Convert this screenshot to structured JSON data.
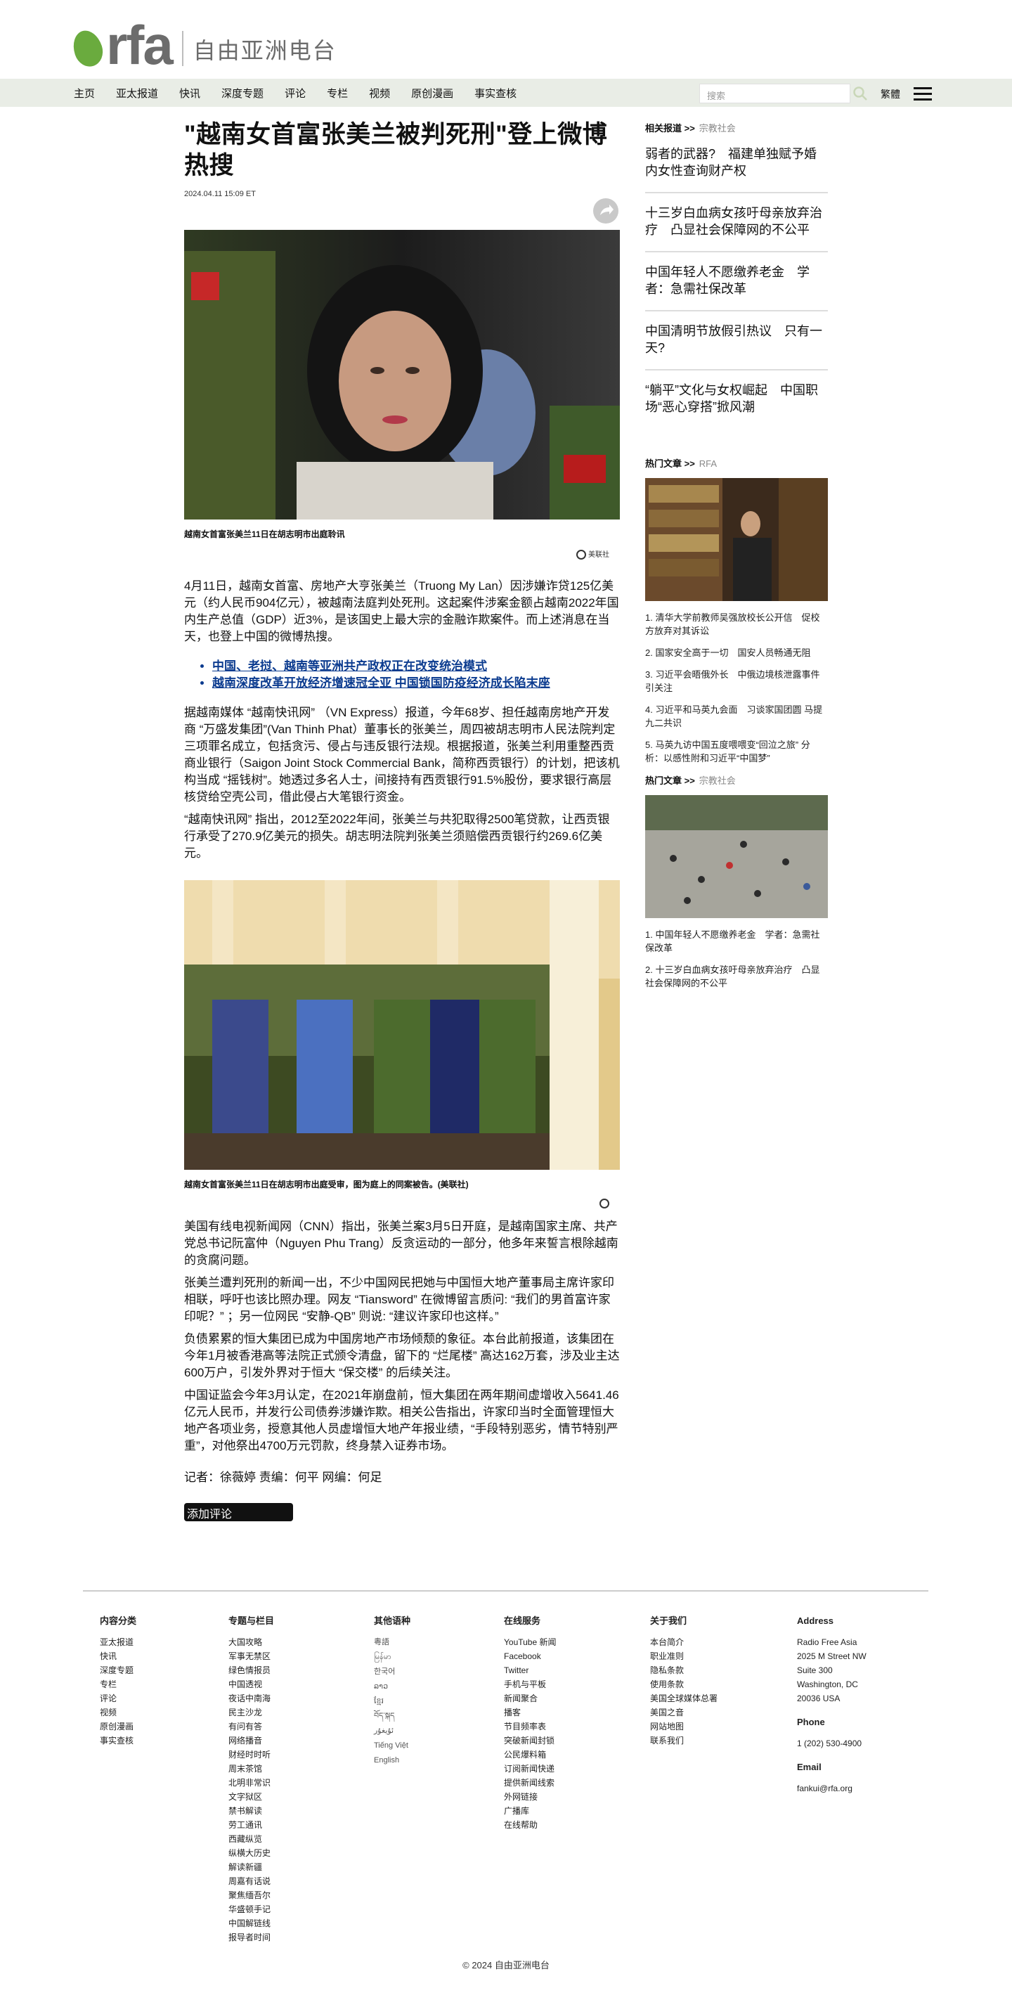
{
  "header": {
    "logo_text": "rfa",
    "site_name": "自由亚洲电台",
    "nav": [
      "主页",
      "亚太报道",
      "快讯",
      "深度专题",
      "评论",
      "专栏",
      "视频",
      "原创漫画",
      "事实查核"
    ],
    "search_placeholder": "搜索",
    "traditional_label": "繁體"
  },
  "article": {
    "title": "\"越南女首富张美兰被判死刑\"登上微博热搜",
    "date": "2024.04.11 15:09 ET",
    "image1_caption": "越南女首富张美兰11日在胡志明市出庭聆讯",
    "image1_credit": "美联社",
    "para1": "4月11日，越南女首富、房地产大亨张美兰（Truong My Lan）因涉嫌诈贷125亿美元（约人民币904亿元），被越南法庭判处死刑。这起案件涉案金额占越南2022年国内生产总值（GDP）近3%，是该国史上最大宗的金融诈欺案件。而上述消息在当天，也登上中国的微博热搜。",
    "links": [
      "中国、老挝、越南等亚洲共产政权正在改变统治模式",
      "越南深度改革开放经济增速冠全亚 中国锁国防疫经济成长陷末座"
    ],
    "para2": "据越南媒体 “越南快讯网” （VN Express）报道，今年68岁、担任越南房地产开发商 “万盛发集团”(Van Thinh Phat）董事长的张美兰，周四被胡志明市人民法院判定三项罪名成立，包括贪污、侵占与违反银行法规。根据报道，张美兰利用重整西贡商业银行（Saigon Joint Stock Commercial Bank，简称西贡银行）的计划，把该机构当成 “摇钱树”。她透过多名人士，间接持有西贡银行91.5%股份，要求银行高层核贷给空壳公司，借此侵占大笔银行资金。",
    "para3": " “越南快讯网” 指出，2012至2022年间，张美兰与共犯取得2500笔贷款，让西贡银行承受了270.9亿美元的损失。胡志明法院判张美兰须赔偿西贡银行约269.6亿美元。",
    "image2_caption": "越南女首富张美兰11日在胡志明市出庭受审，图为庭上的同案被告。(美联社)",
    "para4": "美国有线电视新闻网（CNN）指出，张美兰案3月5日开庭，是越南国家主席、共产党总书记阮富仲（Nguyen Phu Trang）反贪运动的一部分，他多年来誓言根除越南的贪腐问题。",
    "para5": "张美兰遭判死刑的新闻一出，不少中国网民把她与中国恒大地产董事局主席许家印相联，呼吁也该比照办理。网友 “Tiansword” 在微博留言质问: “我们的男首富许家印呢？” ；另一位网民 “安静-QB” 则说: “建议许家印也这样。”",
    "para6": "负债累累的恒大集团已成为中国房地产市场倾颓的象征。本台此前报道，该集团在今年1月被香港高等法院正式颁令清盘，留下的 “烂尾楼” 高达162万套，涉及业主达600万户，引发外界对于恒大 “保交楼” 的后续关注。",
    "para7": "中国证监会今年3月认定，在2021年崩盘前，恒大集团在两年期间虚增收入5641.46亿元人民币，并发行公司债券涉嫌诈欺。相关公告指出，许家印当时全面管理恒大地产各项业务，授意其他人员虚增恒大地产年报业绩，“手段特别恶劣，情节特别严重”，对他祭出4700万元罚款，终身禁入证券市场。",
    "credits": "记者：徐薇婷   责编：何平   网编：何足",
    "comment_button": "添加评论"
  },
  "sidebar": {
    "related_head": "相关报道 >>",
    "related_sub": "宗教社会",
    "related": [
      "弱者的武器?　福建单独赋予婚内女性查询财产权",
      "十三岁白血病女孩吁母亲放弃治疗　凸显社会保障网的不公平",
      "中国年轻人不愿缴养老金　学者：急需社保改革",
      "中国清明节放假引热议　只有一天?",
      "“躺平”文化与女权崛起　中国职场“恶心穿搭”掀风潮"
    ],
    "hot1_head": "热门文章 >>",
    "hot1_sub": "RFA",
    "hot1": [
      "1. 清华大学前教师吴强放校长公开信　促校方放弃对其诉讼",
      "2. 国家安全高于一切　国安人员畅通无阻",
      "3. 习近平会晤俄外长　中俄边境核泄露事件引关注",
      "4. 习近平和马英九会面　习谈家国团圆 马提九二共识",
      "5. 马英九访中国五度喂喂变“回泣之旅” 分析：以感性附和习近平“中国梦”"
    ],
    "hot2_head": "热门文章 >>",
    "hot2_sub": "宗教社会",
    "hot2": [
      "1. 中国年轻人不愿缴养老金　学者：急需社保改革",
      "2. 十三岁白血病女孩吁母亲放弃治疗　凸显社会保障网的不公平"
    ]
  },
  "footer": {
    "col1_head": "内容分类",
    "col1": [
      "亚太报道",
      "快讯",
      "深度专题",
      "专栏",
      "评论",
      "视频",
      "原创漫画",
      "事实查核"
    ],
    "col2_head": "专题与栏目",
    "col2": [
      "大国攻略",
      "军事无禁区",
      "绿色情报员",
      "中国透视",
      "夜话中南海",
      "民主沙龙",
      "有问有答",
      "网络播音",
      "财经时时听",
      "周末茶馆",
      "北明非常识",
      "文字狱区",
      "禁书解读",
      "劳工通讯",
      "西藏纵览",
      "纵横大历史",
      "解读新疆",
      "周嘉有话说",
      "聚焦缅吾尔",
      "华盛顿手记",
      "中国解链线",
      "报导者时间"
    ],
    "col3_head": "其他语种",
    "col3": [
      "粵語",
      " မြန်မာ",
      "한국어",
      "ລາວ",
      "ខ្មែរ",
      "བོད་སྐད",
      "ئۇيغۇر",
      "Tiếng Việt",
      "English"
    ],
    "col4_head": "在线服务",
    "col4": [
      "YouTube 新闻",
      "Facebook",
      "Twitter",
      "手机与平板",
      "新闻聚合",
      "播客",
      "节目频率表",
      "突破新闻封锁",
      "公民爆料箱",
      "订阅新闻快递",
      "提供新闻线索",
      "外网链接",
      "广播库",
      "在线帮助"
    ],
    "col5_head": "关于我们",
    "col5": [
      "本台简介",
      "职业准则",
      "隐私条款",
      "使用条款",
      "美国全球媒体总署",
      "美国之音",
      "网站地图",
      "联系我们"
    ],
    "address_head": "Address",
    "address": [
      "Radio Free Asia",
      "2025 M Street NW",
      "Suite 300",
      "Washington, DC",
      "20036 USA"
    ],
    "phone_head": "Phone",
    "phone": "1 (202) 530-4900",
    "email_head": "Email",
    "email": "fankui@rfa.org",
    "copyright": "© 2024 自由亚洲电台"
  }
}
